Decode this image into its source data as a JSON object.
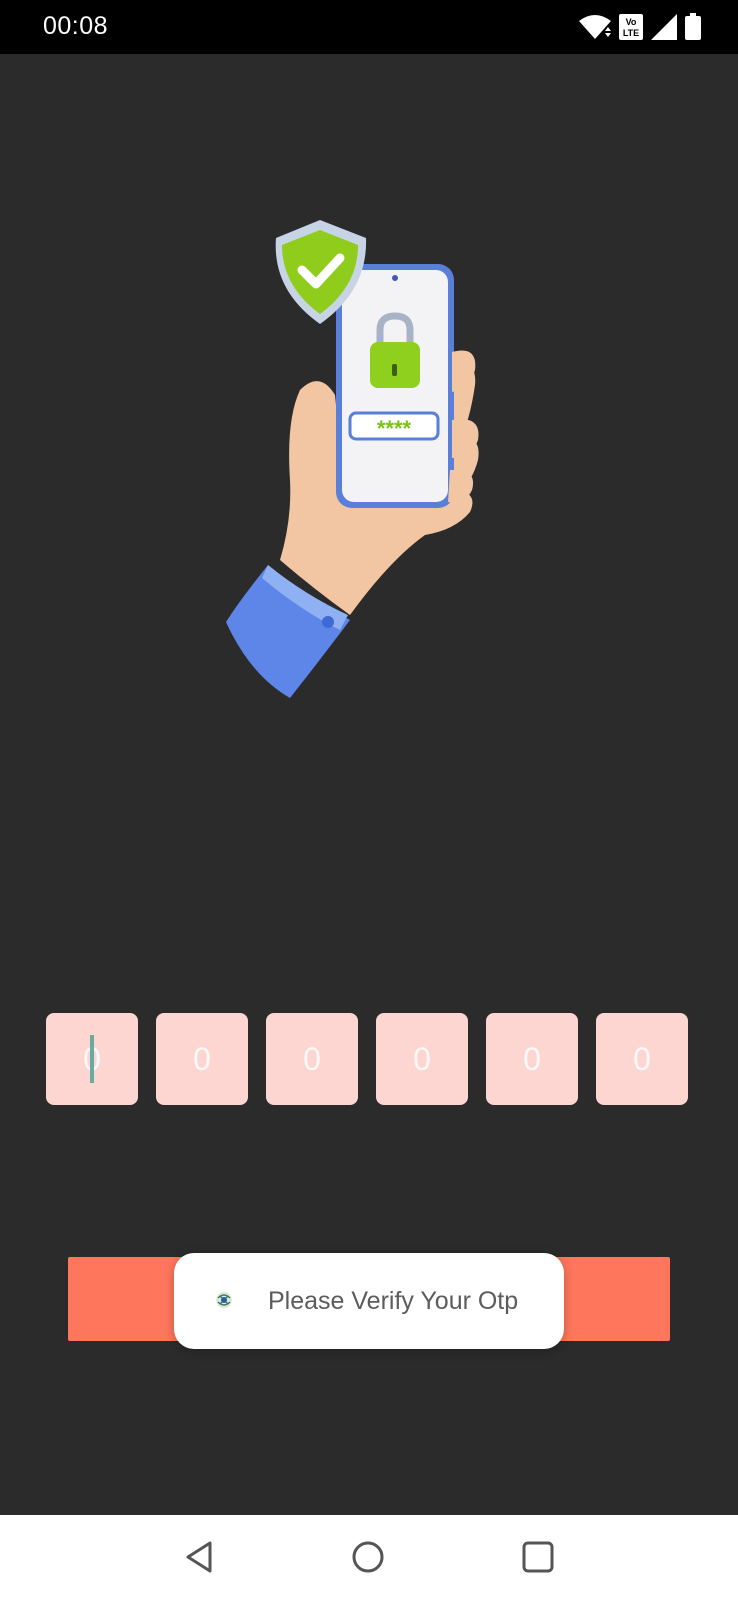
{
  "status_bar": {
    "time": "00:08",
    "icons": [
      "wifi-icon",
      "volte-icon",
      "signal-icon",
      "battery-icon"
    ]
  },
  "illustration": {
    "description_icon": "phone-security-icon",
    "password_mask": "****"
  },
  "otp": {
    "digits": [
      "0",
      "0",
      "0",
      "0",
      "0",
      "0"
    ],
    "box_color": "#fdd6d2"
  },
  "verify_button": {
    "color": "#fe765c"
  },
  "toast": {
    "message": "Please Verify Your Otp"
  },
  "nav_bar": {
    "buttons": [
      "back-icon",
      "home-icon",
      "recents-icon"
    ]
  }
}
